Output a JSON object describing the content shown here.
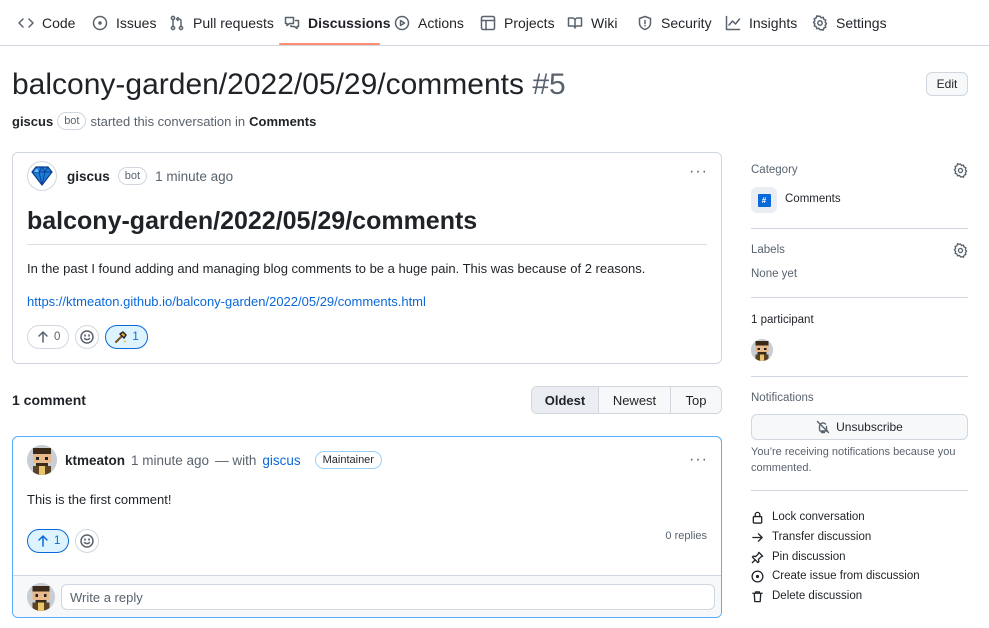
{
  "nav": {
    "items": [
      {
        "label": "Code",
        "icon": "code-icon"
      },
      {
        "label": "Issues",
        "icon": "issue-icon"
      },
      {
        "label": "Pull requests",
        "icon": "pull-request-icon"
      },
      {
        "label": "Discussions",
        "icon": "discussions-icon",
        "active": true
      },
      {
        "label": "Actions",
        "icon": "play-icon"
      },
      {
        "label": "Projects",
        "icon": "table-icon"
      },
      {
        "label": "Wiki",
        "icon": "book-icon"
      },
      {
        "label": "Security",
        "icon": "shield-icon"
      },
      {
        "label": "Insights",
        "icon": "graph-icon"
      },
      {
        "label": "Settings",
        "icon": "gear-icon"
      }
    ],
    "active_color": "#fd8c73"
  },
  "header": {
    "title": "balcony-garden/2022/05/29/comments",
    "number": "#5",
    "edit_label": "Edit",
    "starter": "giscus",
    "starter_badge": "bot",
    "started_text": "started this conversation in",
    "category": "Comments"
  },
  "post": {
    "author": "giscus",
    "author_badge": "bot",
    "time": "1 minute ago",
    "heading": "balcony-garden/2022/05/29/comments",
    "paragraph": "In the past I found adding and managing blog comments to be a huge pain. This was because of 2 reasons.",
    "link": "https://ktmeaton.github.io/balcony-garden/2022/05/29/comments.html",
    "upvotes": "0",
    "reaction_count": "1",
    "reaction_icon": "hammer-sparkle-icon"
  },
  "comments": {
    "count_label": "1 comment",
    "sort": [
      "Oldest",
      "Newest",
      "Top"
    ],
    "sort_active": "Oldest",
    "items": [
      {
        "author": "ktmeaton",
        "time": "1 minute ago",
        "with_text": "— with",
        "via": "giscus",
        "role": "Maintainer",
        "body": "This is the first comment!",
        "upvotes": "1",
        "replies": "0 replies"
      }
    ],
    "reply_placeholder": "Write a reply"
  },
  "sidebar": {
    "category_label": "Category",
    "category_value": "Comments",
    "labels_label": "Labels",
    "labels_value": "None yet",
    "participants_label": "1 participant",
    "notifications_label": "Notifications",
    "unsubscribe_label": "Unsubscribe",
    "notice": "You’re receiving notifications because you commented.",
    "actions": [
      {
        "label": "Lock conversation",
        "icon": "lock-icon"
      },
      {
        "label": "Transfer discussion",
        "icon": "arrow-right-icon"
      },
      {
        "label": "Pin discussion",
        "icon": "pin-icon"
      },
      {
        "label": "Create issue from discussion",
        "icon": "issue-opened-icon"
      },
      {
        "label": "Delete discussion",
        "icon": "trash-icon"
      }
    ]
  },
  "colors": {
    "link": "#0969da",
    "border": "#d0d7de",
    "muted": "#59636e",
    "selected_bg": "#ddf4ff"
  }
}
